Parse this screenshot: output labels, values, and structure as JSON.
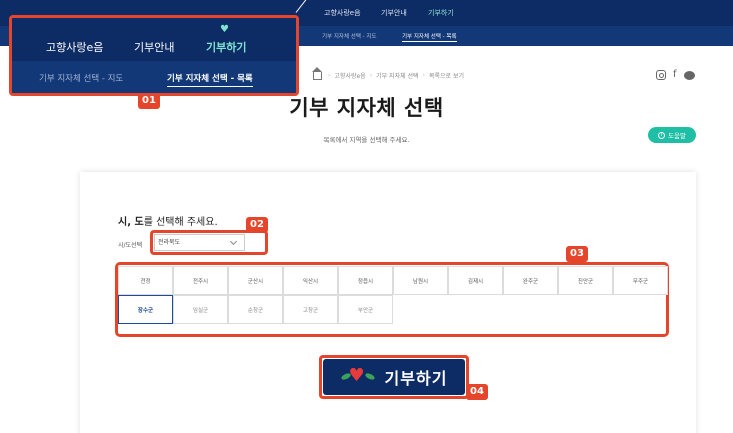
{
  "top_nav": {
    "items": [
      {
        "label": "고향사랑e음",
        "active": false
      },
      {
        "label": "기부안내",
        "active": false
      },
      {
        "label": "기부하기",
        "active": true
      }
    ],
    "sub_items": [
      {
        "label": "기부 지자체 선택 - 지도",
        "active": false
      },
      {
        "label": "기부 지자체 선택 - 목록",
        "active": true
      }
    ]
  },
  "badges": [
    "01",
    "02",
    "03",
    "04"
  ],
  "breadcrumb": [
    "고향사랑e음",
    "기부 지자체 선택",
    "목록으로 보기"
  ],
  "page": {
    "title": "기부 지자체 선택",
    "subtitle": "목록에서 지역을 선택해 주세요.",
    "help_label": "도움말"
  },
  "form": {
    "section_label_bold": "시, 도",
    "section_label_rest": "를 선택해 주세요.",
    "field_label": "시/도선택",
    "selected_region": "전라북도"
  },
  "cities": [
    [
      "전정",
      "전주시",
      "군산시",
      "익산시",
      "정읍시",
      "남원시",
      "김제시",
      "완주군",
      "진안군",
      "무주군"
    ],
    [
      "장수군",
      "임실군",
      "순창군",
      "고창군",
      "부안군"
    ]
  ],
  "selected_city": "장수군",
  "donate_label": "기부하기",
  "colors": {
    "nav_dark": "#0d2b64",
    "nav_sub": "#123877",
    "accent_teal": "#1fbfa6",
    "highlight": "#e5462b",
    "selected": "#1d4b9b"
  }
}
